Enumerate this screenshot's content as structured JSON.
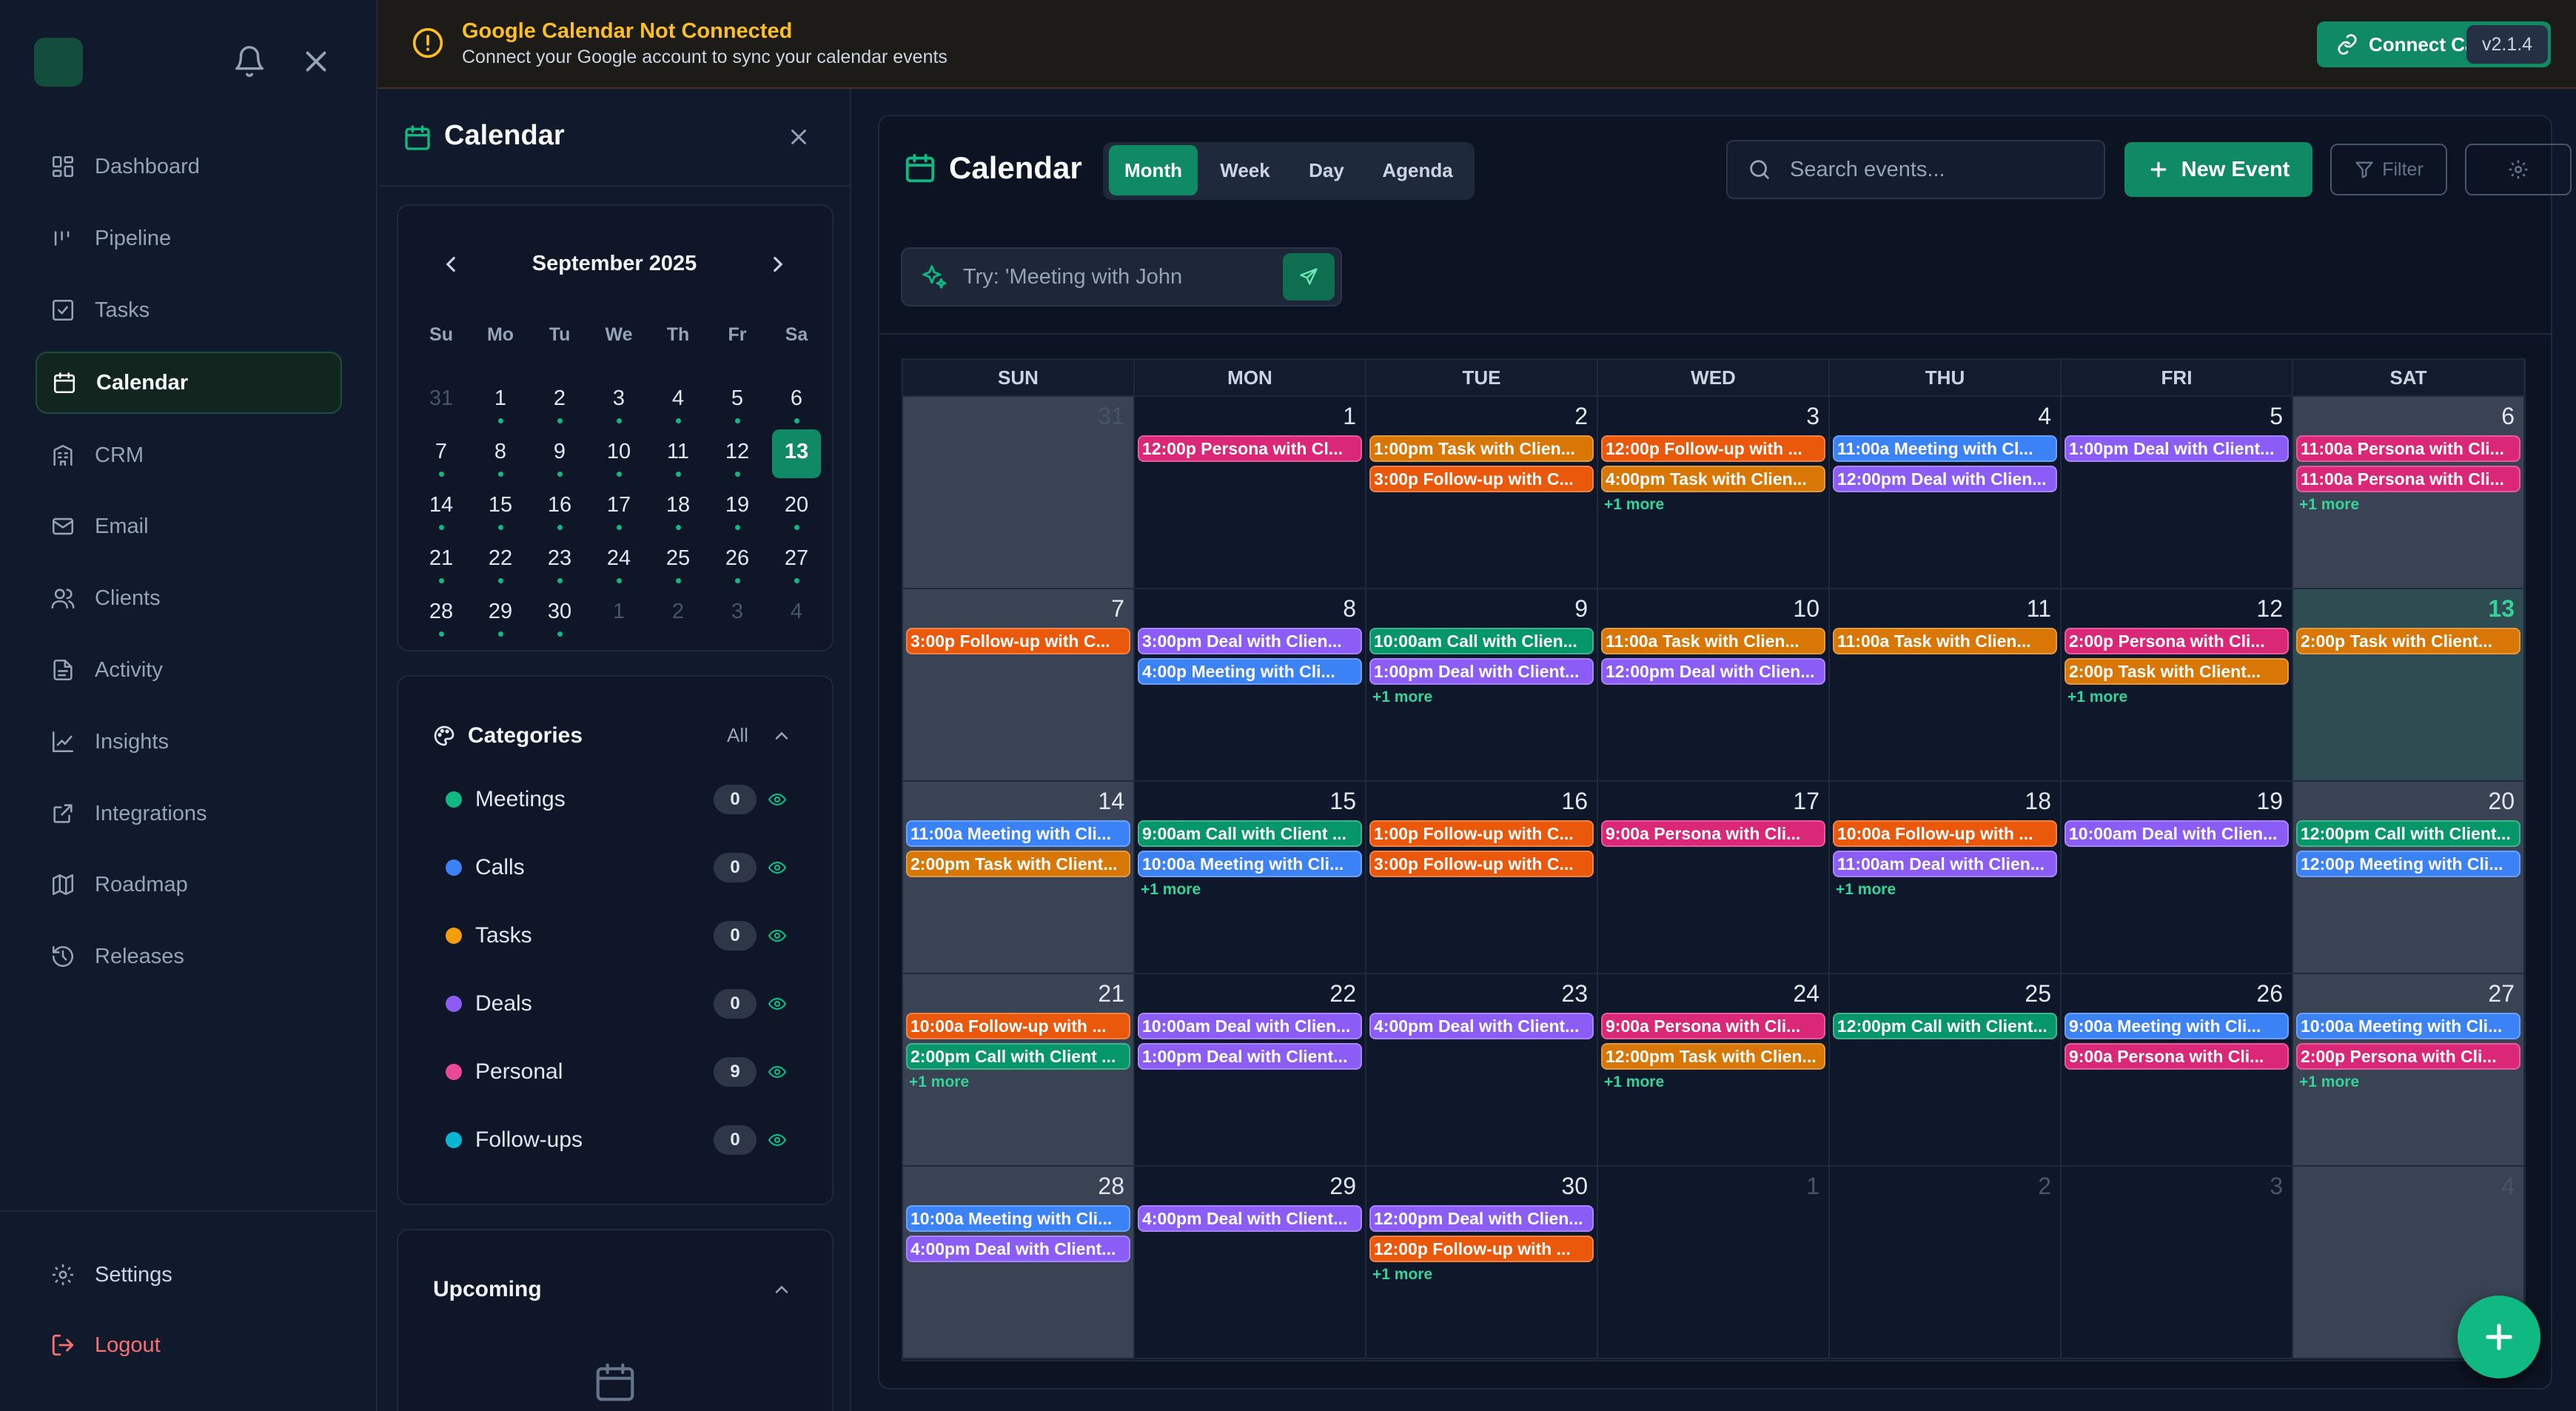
{
  "nav": {
    "items": [
      {
        "label": "Dashboard",
        "icon": "dashboard-icon"
      },
      {
        "label": "Pipeline",
        "icon": "pipeline-icon"
      },
      {
        "label": "Tasks",
        "icon": "tasks-icon"
      },
      {
        "label": "Calendar",
        "icon": "calendar-icon",
        "active": true
      },
      {
        "label": "CRM",
        "icon": "crm-icon"
      },
      {
        "label": "Email",
        "icon": "email-icon"
      },
      {
        "label": "Clients",
        "icon": "clients-icon"
      },
      {
        "label": "Activity",
        "icon": "activity-icon"
      },
      {
        "label": "Insights",
        "icon": "insights-icon"
      },
      {
        "label": "Integrations",
        "icon": "integrations-icon"
      },
      {
        "label": "Roadmap",
        "icon": "roadmap-icon"
      },
      {
        "label": "Releases",
        "icon": "releases-icon"
      }
    ],
    "settings_label": "Settings",
    "logout_label": "Logout"
  },
  "banner": {
    "title": "Google Calendar Not Connected",
    "subtitle": "Connect your Google account to sync your calendar events",
    "connect_label": "Connect Calendar",
    "version": "v2.1.4"
  },
  "panel": {
    "title": "Calendar",
    "mini": {
      "month_label": "September 2025",
      "weekdays": [
        "Su",
        "Mo",
        "Tu",
        "We",
        "Th",
        "Fr",
        "Sa"
      ],
      "weeks": [
        [
          {
            "d": "31",
            "o": true
          },
          {
            "d": "1",
            "e": true
          },
          {
            "d": "2",
            "e": true
          },
          {
            "d": "3",
            "e": true
          },
          {
            "d": "4",
            "e": true
          },
          {
            "d": "5",
            "e": true
          },
          {
            "d": "6",
            "e": true
          }
        ],
        [
          {
            "d": "7",
            "e": true
          },
          {
            "d": "8",
            "e": true
          },
          {
            "d": "9",
            "e": true
          },
          {
            "d": "10",
            "e": true
          },
          {
            "d": "11",
            "e": true
          },
          {
            "d": "12",
            "e": true
          },
          {
            "d": "13",
            "sel": true
          }
        ],
        [
          {
            "d": "14",
            "e": true
          },
          {
            "d": "15",
            "e": true
          },
          {
            "d": "16",
            "e": true
          },
          {
            "d": "17",
            "e": true
          },
          {
            "d": "18",
            "e": true
          },
          {
            "d": "19",
            "e": true
          },
          {
            "d": "20",
            "e": true
          }
        ],
        [
          {
            "d": "21",
            "e": true
          },
          {
            "d": "22",
            "e": true
          },
          {
            "d": "23",
            "e": true
          },
          {
            "d": "24",
            "e": true
          },
          {
            "d": "25",
            "e": true
          },
          {
            "d": "26",
            "e": true
          },
          {
            "d": "27",
            "e": true
          }
        ],
        [
          {
            "d": "28",
            "e": true
          },
          {
            "d": "29",
            "e": true
          },
          {
            "d": "30",
            "e": true
          },
          {
            "d": "1",
            "o": true
          },
          {
            "d": "2",
            "o": true
          },
          {
            "d": "3",
            "o": true
          },
          {
            "d": "4",
            "o": true
          }
        ]
      ]
    },
    "categories": {
      "title": "Categories",
      "all_label": "All",
      "items": [
        {
          "label": "Meetings",
          "count": "0",
          "color": "#10b981"
        },
        {
          "label": "Calls",
          "count": "0",
          "color": "#3b82f6"
        },
        {
          "label": "Tasks",
          "count": "0",
          "color": "#f59e0b"
        },
        {
          "label": "Deals",
          "count": "0",
          "color": "#8b5cf6"
        },
        {
          "label": "Personal",
          "count": "9",
          "color": "#ec4899"
        },
        {
          "label": "Follow-ups",
          "count": "0",
          "color": "#06b6d4"
        }
      ]
    },
    "upcoming_title": "Upcoming"
  },
  "main": {
    "title": "Calendar",
    "views": [
      "Month",
      "Week",
      "Day",
      "Agenda"
    ],
    "active_view": "Month",
    "search_placeholder": "Search events...",
    "new_event_label": "New Event",
    "filter_label": "Filter",
    "ai_placeholder": "Try: 'Meeting with John"
  },
  "calendar": {
    "colors": {
      "pink": "#db2777",
      "orange": "#ea580c",
      "amber": "#d97706",
      "blue": "#3b82f6",
      "purple": "#8b5cf6",
      "green": "#059669"
    },
    "weekdays": [
      "SUN",
      "MON",
      "TUE",
      "WED",
      "THU",
      "FRI",
      "SAT"
    ],
    "weeks": [
      [
        {
          "d": "31",
          "other": true,
          "events": []
        },
        {
          "d": "1",
          "events": [
            {
              "t": "12:00p",
              "x": "Persona with Cl...",
              "c": "pink"
            }
          ]
        },
        {
          "d": "2",
          "events": [
            {
              "t": "1:00pm",
              "x": "Task with Clien...",
              "c": "amber"
            },
            {
              "t": "3:00p",
              "x": "Follow-up with C...",
              "c": "orange"
            }
          ]
        },
        {
          "d": "3",
          "events": [
            {
              "t": "12:00p",
              "x": "Follow-up with ...",
              "c": "orange"
            },
            {
              "t": "4:00pm",
              "x": "Task with Clien...",
              "c": "amber"
            }
          ],
          "more": "+1 more"
        },
        {
          "d": "4",
          "events": [
            {
              "t": "11:00a",
              "x": "Meeting with Cl...",
              "c": "blue"
            },
            {
              "t": "12:00pm",
              "x": "Deal with Clien...",
              "c": "purple"
            }
          ]
        },
        {
          "d": "5",
          "events": [
            {
              "t": "1:00pm",
              "x": "Deal with Client...",
              "c": "purple"
            }
          ]
        },
        {
          "d": "6",
          "events": [
            {
              "t": "11:00a",
              "x": "Persona with Cli...",
              "c": "pink"
            },
            {
              "t": "11:00a",
              "x": "Persona with Cli...",
              "c": "pink"
            }
          ],
          "more": "+1 more"
        }
      ],
      [
        {
          "d": "7",
          "events": [
            {
              "t": "3:00p",
              "x": "Follow-up with C...",
              "c": "orange"
            }
          ]
        },
        {
          "d": "8",
          "events": [
            {
              "t": "3:00pm",
              "x": "Deal with Clien...",
              "c": "purple"
            },
            {
              "t": "4:00p",
              "x": "Meeting with Cli...",
              "c": "blue"
            }
          ]
        },
        {
          "d": "9",
          "events": [
            {
              "t": "10:00am",
              "x": "Call with Clien...",
              "c": "green"
            },
            {
              "t": "1:00pm",
              "x": "Deal with Client...",
              "c": "purple"
            }
          ],
          "more": "+1 more"
        },
        {
          "d": "10",
          "events": [
            {
              "t": "11:00a",
              "x": "Task with Clien...",
              "c": "amber"
            },
            {
              "t": "12:00pm",
              "x": "Deal with Clien...",
              "c": "purple"
            }
          ]
        },
        {
          "d": "11",
          "events": [
            {
              "t": "11:00a",
              "x": "Task with Clien...",
              "c": "amber"
            }
          ]
        },
        {
          "d": "12",
          "events": [
            {
              "t": "2:00p",
              "x": "Persona with Cli...",
              "c": "pink"
            },
            {
              "t": "2:00p",
              "x": "Task with Client...",
              "c": "amber"
            }
          ],
          "more": "+1 more"
        },
        {
          "d": "13",
          "today": true,
          "events": [
            {
              "t": "2:00p",
              "x": "Task with Client...",
              "c": "amber"
            }
          ]
        }
      ],
      [
        {
          "d": "14",
          "events": [
            {
              "t": "11:00a",
              "x": "Meeting with Cli...",
              "c": "blue"
            },
            {
              "t": "2:00pm",
              "x": "Task with Client...",
              "c": "amber"
            }
          ]
        },
        {
          "d": "15",
          "events": [
            {
              "t": "9:00am",
              "x": "Call with Client ...",
              "c": "green"
            },
            {
              "t": "10:00a",
              "x": "Meeting with Cli...",
              "c": "blue"
            }
          ],
          "more": "+1 more"
        },
        {
          "d": "16",
          "events": [
            {
              "t": "1:00p",
              "x": "Follow-up with C...",
              "c": "orange"
            },
            {
              "t": "3:00p",
              "x": "Follow-up with C...",
              "c": "orange"
            }
          ]
        },
        {
          "d": "17",
          "events": [
            {
              "t": "9:00a",
              "x": "Persona with Cli...",
              "c": "pink"
            }
          ]
        },
        {
          "d": "18",
          "events": [
            {
              "t": "10:00a",
              "x": "Follow-up with ...",
              "c": "orange"
            },
            {
              "t": "11:00am",
              "x": "Deal with Clien...",
              "c": "purple"
            }
          ],
          "more": "+1 more"
        },
        {
          "d": "19",
          "events": [
            {
              "t": "10:00am",
              "x": "Deal with Clien...",
              "c": "purple"
            }
          ]
        },
        {
          "d": "20",
          "events": [
            {
              "t": "12:00pm",
              "x": "Call with Client...",
              "c": "green"
            },
            {
              "t": "12:00p",
              "x": "Meeting with Cli...",
              "c": "blue"
            }
          ]
        }
      ],
      [
        {
          "d": "21",
          "events": [
            {
              "t": "10:00a",
              "x": "Follow-up with ...",
              "c": "orange"
            },
            {
              "t": "2:00pm",
              "x": "Call with Client ...",
              "c": "green"
            }
          ],
          "more": "+1 more"
        },
        {
          "d": "22",
          "events": [
            {
              "t": "10:00am",
              "x": "Deal with Clien...",
              "c": "purple"
            },
            {
              "t": "1:00pm",
              "x": "Deal with Client...",
              "c": "purple"
            }
          ]
        },
        {
          "d": "23",
          "events": [
            {
              "t": "4:00pm",
              "x": "Deal with Client...",
              "c": "purple"
            }
          ]
        },
        {
          "d": "24",
          "events": [
            {
              "t": "9:00a",
              "x": "Persona with Cli...",
              "c": "pink"
            },
            {
              "t": "12:00pm",
              "x": "Task with Clien...",
              "c": "amber"
            }
          ],
          "more": "+1 more"
        },
        {
          "d": "25",
          "events": [
            {
              "t": "12:00pm",
              "x": "Call with Client...",
              "c": "green"
            }
          ]
        },
        {
          "d": "26",
          "events": [
            {
              "t": "9:00a",
              "x": "Meeting with Cli...",
              "c": "blue"
            },
            {
              "t": "9:00a",
              "x": "Persona with Cli...",
              "c": "pink"
            }
          ]
        },
        {
          "d": "27",
          "events": [
            {
              "t": "10:00a",
              "x": "Meeting with Cli...",
              "c": "blue"
            },
            {
              "t": "2:00p",
              "x": "Persona with Cli...",
              "c": "pink"
            }
          ],
          "more": "+1 more"
        }
      ],
      [
        {
          "d": "28",
          "events": [
            {
              "t": "10:00a",
              "x": "Meeting with Cli...",
              "c": "blue"
            },
            {
              "t": "4:00pm",
              "x": "Deal with Client...",
              "c": "purple"
            }
          ]
        },
        {
          "d": "29",
          "events": [
            {
              "t": "4:00pm",
              "x": "Deal with Client...",
              "c": "purple"
            }
          ]
        },
        {
          "d": "30",
          "events": [
            {
              "t": "12:00pm",
              "x": "Deal with Clien...",
              "c": "purple"
            },
            {
              "t": "12:00p",
              "x": "Follow-up with ...",
              "c": "orange"
            }
          ],
          "more": "+1 more"
        },
        {
          "d": "1",
          "other": true,
          "events": []
        },
        {
          "d": "2",
          "other": true,
          "events": []
        },
        {
          "d": "3",
          "other": true,
          "events": []
        },
        {
          "d": "4",
          "other": true,
          "events": []
        }
      ]
    ]
  }
}
